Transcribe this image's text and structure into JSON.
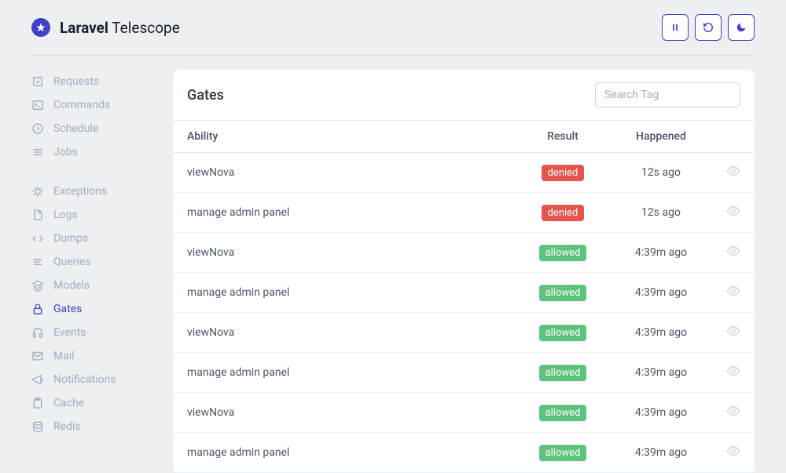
{
  "brand": {
    "bold": "Laravel",
    "light": "Telescope"
  },
  "header_icons": [
    "pause",
    "refresh",
    "moon"
  ],
  "sidebar": {
    "sections": [
      {
        "items": [
          {
            "icon": "request",
            "label": "Requests"
          },
          {
            "icon": "terminal",
            "label": "Commands"
          },
          {
            "icon": "clock",
            "label": "Schedule"
          },
          {
            "icon": "list",
            "label": "Jobs"
          }
        ]
      },
      {
        "items": [
          {
            "icon": "bug",
            "label": "Exceptions"
          },
          {
            "icon": "file",
            "label": "Logs"
          },
          {
            "icon": "code",
            "label": "Dumps"
          },
          {
            "icon": "lines",
            "label": "Queries"
          },
          {
            "icon": "layers",
            "label": "Models"
          },
          {
            "icon": "lock",
            "label": "Gates",
            "active": true
          },
          {
            "icon": "headphones",
            "label": "Events"
          },
          {
            "icon": "mail",
            "label": "Mail"
          },
          {
            "icon": "megaphone",
            "label": "Notifications"
          },
          {
            "icon": "clipboard",
            "label": "Cache"
          },
          {
            "icon": "database",
            "label": "Redis"
          }
        ]
      }
    ]
  },
  "panel": {
    "title": "Gates",
    "search_placeholder": "Search Tag",
    "columns": {
      "ability": "Ability",
      "result": "Result",
      "happened": "Happened"
    },
    "rows": [
      {
        "ability": "viewNova",
        "result": "denied",
        "happened": "12s ago"
      },
      {
        "ability": "manage admin panel",
        "result": "denied",
        "happened": "12s ago"
      },
      {
        "ability": "viewNova",
        "result": "allowed",
        "happened": "4:39m ago"
      },
      {
        "ability": "manage admin panel",
        "result": "allowed",
        "happened": "4:39m ago"
      },
      {
        "ability": "viewNova",
        "result": "allowed",
        "happened": "4:39m ago"
      },
      {
        "ability": "manage admin panel",
        "result": "allowed",
        "happened": "4:39m ago"
      },
      {
        "ability": "viewNova",
        "result": "allowed",
        "happened": "4:39m ago"
      },
      {
        "ability": "manage admin panel",
        "result": "allowed",
        "happened": "4:39m ago"
      }
    ]
  }
}
